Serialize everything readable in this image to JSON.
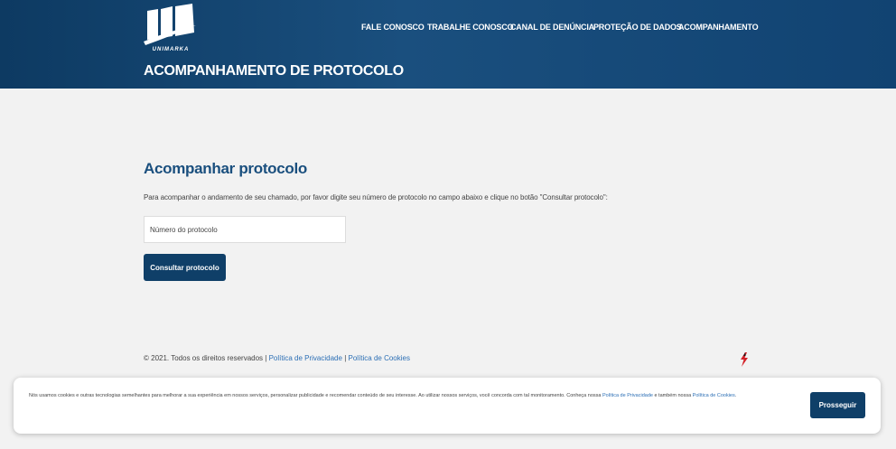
{
  "header": {
    "logo_text": "UNIMARKA",
    "nav": [
      {
        "label": "FALE CONOSCO"
      },
      {
        "label": "TRABALHE CONOSCO"
      },
      {
        "label": "CANAL DE DENÚNCIA"
      },
      {
        "label": "PROTEÇÃO DE DADOS"
      },
      {
        "label": "ACOMPANHAMENTO"
      }
    ],
    "page_title": "ACOMPANHAMENTO DE PROTOCOLO"
  },
  "main": {
    "section_title": "Acompanhar protocolo",
    "intro": "Para acompanhar o andamento de seu chamado, por favor digite seu número de protocolo no campo abaixo e clique no botão \"Consultar protocolo\":",
    "input_placeholder": "Número do protocolo",
    "submit_label": "Consultar protocolo"
  },
  "footer": {
    "copyright": "© 2021. Todos os direitos reservados | ",
    "privacy_link": "Política de Privacidade",
    "separator": " | ",
    "cookies_link": "Política de Cookies",
    "icon": "bolt-icon"
  },
  "cookie_banner": {
    "text_before": "Nós usamos cookies e outras tecnologias semelhantes para melhorar a sua experiência em nossos serviços, personalizar publicidade e recomendar conteúdo de seu interesse. Ao utilizar nossos serviços, você concorda com tal monitoramento. Conheça nossa ",
    "privacy_link": "Política de Privacidade",
    "text_middle": " e também nossa ",
    "cookies_link": "Política de Cookies",
    "text_after": ".",
    "button_label": "Prosseguir"
  },
  "colors": {
    "header_blue": "#1a4f7e",
    "button_blue": "#0f3f68",
    "link_blue": "#2c6fb5",
    "background": "#f2f2f2"
  }
}
